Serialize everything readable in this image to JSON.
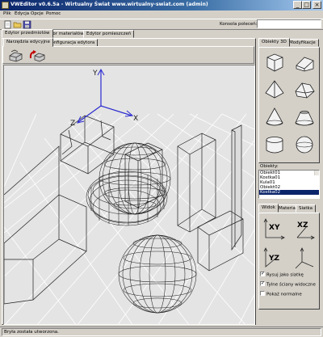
{
  "window": {
    "title": "VWEditor v0.6.5a - Wirtualny Świat www.wirtualny-swiat.com (admin)",
    "controls": [
      "_",
      "□",
      "×"
    ]
  },
  "menu": [
    "Plik",
    "Edycja",
    "Opcje",
    "Pomoc"
  ],
  "toolbar": {
    "icons": [
      "new-file-icon",
      "open-folder-icon",
      "save-icon"
    ],
    "command_label": "Konsola poleceń:",
    "command_value": ""
  },
  "main_tabs": [
    "Edytor przedmiotów",
    "Edytor materiałów",
    "Edytor pomieszczeń"
  ],
  "sub_tabs": [
    "Narzędzia edycyjne",
    "Konfiguracja edytora"
  ],
  "viewport": {
    "axis_labels": {
      "y": "Y",
      "x": "X",
      "z": "Z",
      "z_small": "Z"
    }
  },
  "right_tabs": [
    "Obiekty 3D",
    "Modyfikacje"
  ],
  "shapes": [
    "cube-icon",
    "wedge-icon",
    "tetrahedron-icon",
    "truncated-wedge-icon",
    "cone-icon",
    "truncated-cone-icon",
    "cylinder-icon",
    "sphere-icon"
  ],
  "objects": {
    "label": "Obiekty:",
    "items": [
      "Obiekt01",
      "Kostka01",
      "Kula01",
      "Obiekt02",
      "Kostka02"
    ]
  },
  "view_tabs": [
    "Widok",
    "Materiał",
    "Siatka"
  ],
  "views": [
    "XY",
    "XZ",
    "YZ",
    ""
  ],
  "checkboxes": [
    {
      "label": "Rysuj jako siatkę",
      "checked": true
    },
    {
      "label": "Tylne ściany widoczne",
      "checked": true
    },
    {
      "label": "Pokaż normalne",
      "checked": false
    }
  ],
  "status": "Bryła została utworzona."
}
